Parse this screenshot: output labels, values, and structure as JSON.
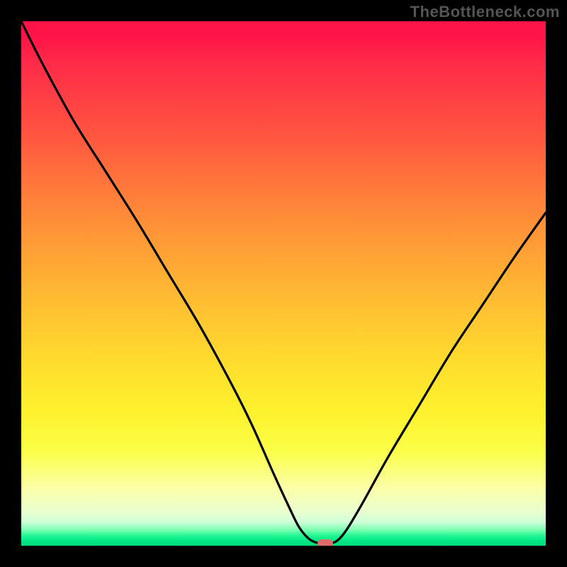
{
  "watermark": "TheBottleneck.com",
  "colors": {
    "frame": "#000000",
    "curve": "#000000",
    "marker": "#e16a6a",
    "gradient_top": "#ff1447",
    "gradient_bottom": "#02d97c"
  },
  "chart_data": {
    "type": "line",
    "title": "",
    "xlabel": "",
    "ylabel": "",
    "xlim": [
      0,
      100
    ],
    "ylim": [
      0,
      100
    ],
    "note": "Axes are implicit (no tick labels shown). x and y normalized 0–100. y grows upward; 0 is the green baseline, 100 the top red.",
    "x": [
      0,
      4,
      10,
      16,
      22,
      28,
      34,
      40,
      44,
      48,
      51,
      53,
      55,
      57,
      58,
      60,
      62,
      65,
      70,
      76,
      82,
      88,
      94,
      100
    ],
    "y": [
      100,
      92,
      81,
      71.5,
      62,
      52,
      42,
      31,
      23,
      14,
      7.5,
      3.5,
      1.2,
      0.4,
      0.4,
      0.8,
      3,
      8,
      17,
      27,
      37,
      46,
      55,
      63.5
    ],
    "min_region_x": [
      55,
      60
    ],
    "marker": {
      "x": 58,
      "y": 0.4
    }
  }
}
